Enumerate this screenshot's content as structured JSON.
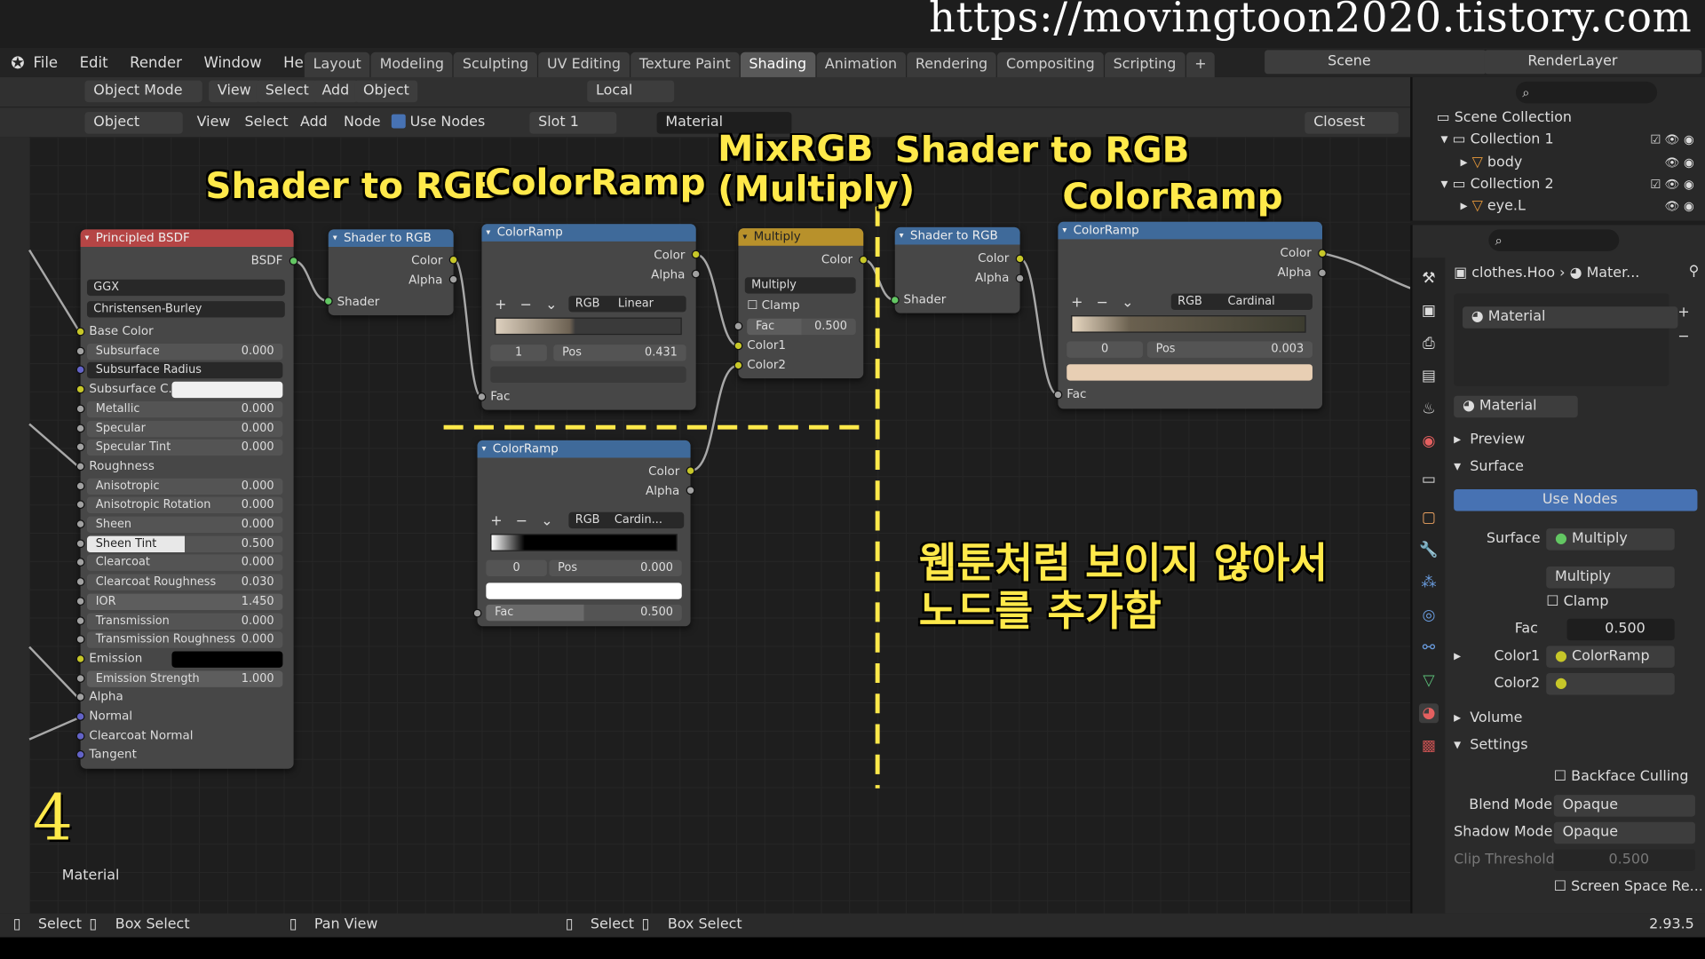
{
  "url": "https://movingtoon2020.tistory.com",
  "menu": [
    "File",
    "Edit",
    "Render",
    "Window",
    "Help"
  ],
  "workspaces": [
    "Layout",
    "Modeling",
    "Sculpting",
    "UV Editing",
    "Texture Paint",
    "Shading",
    "Animation",
    "Rendering",
    "Compositing",
    "Scripting",
    "+"
  ],
  "scene": "Scene",
  "render_layer": "RenderLayer",
  "viewport_header": {
    "mode": "Object Mode",
    "view": "View",
    "select": "Select",
    "add": "Add",
    "object": "Object",
    "orient": "Local"
  },
  "node_header": {
    "type": "Object",
    "view": "View",
    "select": "Select",
    "add": "Add",
    "node": "Node",
    "use_nodes": "Use Nodes",
    "slot": "Slot 1",
    "material": "Material",
    "interp": "Closest"
  },
  "captions": {
    "c1": "Shader to RGB",
    "c2": "ColorRamp",
    "c3a": "MixRGB",
    "c3b": "(Multiply)",
    "c4": "Shader to RGB",
    "c5": "ColorRamp",
    "korean1": "웹툰처럼 보이지 않아서",
    "korean2": "노드를 추가함",
    "step": "4",
    "editor_label": "Material"
  },
  "bsdf": {
    "title": "Principled BSDF",
    "out": "BSDF",
    "dist": "GGX",
    "sss": "Christensen-Burley",
    "rows": [
      [
        "Base Color",
        ""
      ],
      [
        "Subsurface",
        "0.000"
      ],
      [
        "Subsurface Radius",
        ""
      ],
      [
        "Subsurface C...",
        ""
      ],
      [
        "Metallic",
        "0.000"
      ],
      [
        "Specular",
        "0.000"
      ],
      [
        "Specular Tint",
        "0.000"
      ],
      [
        "Roughness",
        ""
      ],
      [
        "Anisotropic",
        "0.000"
      ],
      [
        "Anisotropic Rotation",
        "0.000"
      ],
      [
        "Sheen",
        "0.000"
      ],
      [
        "Sheen Tint",
        "0.500"
      ],
      [
        "Clearcoat",
        "0.000"
      ],
      [
        "Clearcoat Roughness",
        "0.030"
      ],
      [
        "IOR",
        "1.450"
      ],
      [
        "Transmission",
        "0.000"
      ],
      [
        "Transmission Roughness",
        "0.000"
      ],
      [
        "Emission",
        ""
      ],
      [
        "Emission Strength",
        "1.000"
      ],
      [
        "Alpha",
        ""
      ],
      [
        "Normal",
        ""
      ],
      [
        "Clearcoat Normal",
        ""
      ],
      [
        "Tangent",
        ""
      ]
    ]
  },
  "s2rgb1": {
    "title": "Shader to RGB",
    "color": "Color",
    "alpha": "Alpha",
    "shader": "Shader"
  },
  "ramp1": {
    "title": "ColorRamp",
    "color": "Color",
    "alpha": "Alpha",
    "mode": "RGB",
    "interp": "Linear",
    "index": "1",
    "pos_label": "Pos",
    "pos": "0.431",
    "fac": "Fac"
  },
  "mix": {
    "title": "Multiply",
    "color": "Color",
    "blend": "Multiply",
    "clamp": "Clamp",
    "fac_label": "Fac",
    "fac": "0.500",
    "c1": "Color1",
    "c2": "Color2"
  },
  "ramp2": {
    "title": "ColorRamp",
    "color": "Color",
    "alpha": "Alpha",
    "mode": "RGB",
    "interp": "Cardin...",
    "index": "0",
    "pos_label": "Pos",
    "pos": "0.000",
    "fac_label": "Fac",
    "fac": "0.500"
  },
  "s2rgb2": {
    "title": "Shader to RGB",
    "color": "Color",
    "alpha": "Alpha",
    "shader": "Shader"
  },
  "ramp3": {
    "title": "ColorRamp",
    "color": "Color",
    "alpha": "Alpha",
    "mode": "RGB",
    "interp": "Cardinal",
    "index": "0",
    "pos_label": "Pos",
    "pos": "0.003",
    "fac": "Fac"
  },
  "outliner": {
    "root": "Scene Collection",
    "c1": "Collection 1",
    "body": "body",
    "c2": "Collection 2",
    "eye": "eye.L"
  },
  "props": {
    "breadcrumb_obj": "clothes.Hoo",
    "breadcrumb_mat": "Mater...",
    "slot": "Material",
    "mat_name": "Material",
    "preview": "Preview",
    "surface_panel": "Surface",
    "use_nodes": "Use Nodes",
    "surface_label": "Surface",
    "surface_val": "Multiply",
    "blend_val": "Multiply",
    "clamp": "Clamp",
    "fac_label": "Fac",
    "fac": "0.500",
    "color1_label": "Color1",
    "color1_val": "ColorRamp",
    "color2_label": "Color2",
    "volume": "Volume",
    "settings": "Settings",
    "backface": "Backface Culling",
    "blend_mode_label": "Blend Mode",
    "blend_mode": "Opaque",
    "shadow_mode_label": "Shadow Mode",
    "shadow_mode": "Opaque",
    "clip_label": "Clip Threshold",
    "clip": "0.500",
    "ssr": "Screen Space Re..."
  },
  "status": {
    "s1": "Select",
    "s2": "Box Select",
    "s3": "Pan View",
    "s4": "Select",
    "s5": "Box Select",
    "version": "2.93.5"
  }
}
